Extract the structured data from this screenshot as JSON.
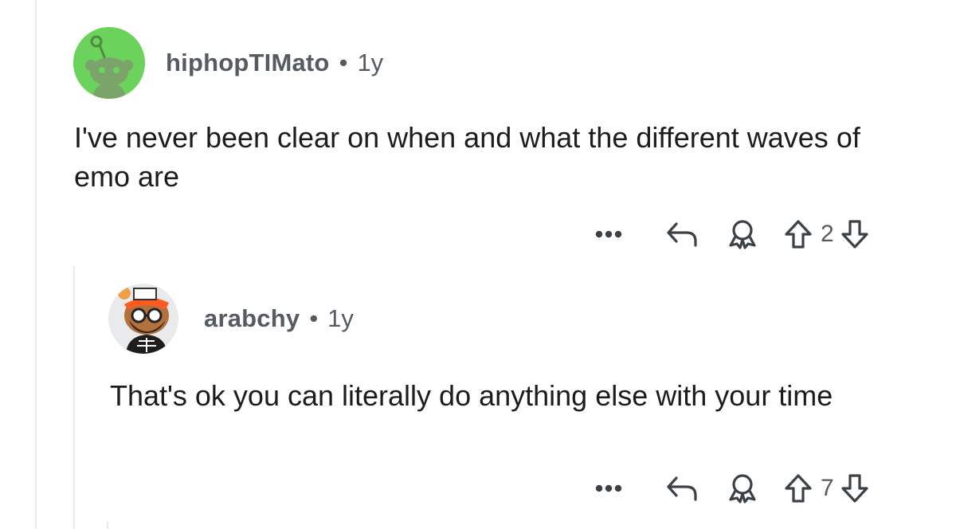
{
  "comments": [
    {
      "username": "hiphopTIMato",
      "separator": "•",
      "age": "1y",
      "body": "I've never been clear on when and what the different waves of emo are",
      "votes": "2",
      "avatar_bg": "#6bd35c"
    },
    {
      "username": "arabchy",
      "separator": "•",
      "age": "1y",
      "body": "That's ok you can literally do anything else with your time",
      "votes": "7",
      "avatar_bg": "#e9eaeb"
    }
  ],
  "icons": {
    "more": "ellipsis-icon",
    "reply": "reply-icon",
    "award": "award-icon",
    "upvote": "upvote-arrow-icon",
    "downvote": "downvote-arrow-icon"
  }
}
